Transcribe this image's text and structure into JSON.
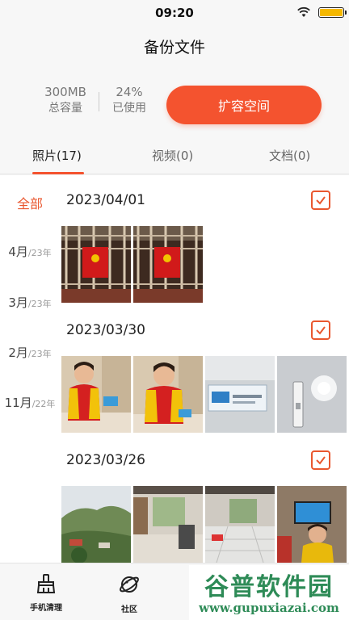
{
  "status_bar": {
    "time": "09:20",
    "battery_color": "#f5b800"
  },
  "header": {
    "title": "备份文件"
  },
  "storage": {
    "capacity_value": "300MB",
    "capacity_label": "总容量",
    "used_value": "24%",
    "used_label": "已使用",
    "expand_button": "扩容空间",
    "accent_color": "#f4532f"
  },
  "tabs": [
    {
      "label": "照片(17)",
      "active": true
    },
    {
      "label": "视频(0)",
      "active": false
    },
    {
      "label": "文档(0)",
      "active": false
    }
  ],
  "timeline": [
    {
      "main": "全部",
      "sub": ""
    },
    {
      "main": "4月",
      "sub": "/23年"
    },
    {
      "main": "3月",
      "sub": "/23年"
    },
    {
      "main": "2月",
      "sub": "/23年"
    },
    {
      "main": "11月",
      "sub": "/22年"
    }
  ],
  "groups": [
    {
      "date": "2023/04/01",
      "checked": true,
      "photos": [
        "red-banner-ceiling",
        "red-banner-ceiling"
      ]
    },
    {
      "date": "2023/03/30",
      "checked": true,
      "photos": [
        "child-yellow-vest",
        "child-yellow-vest",
        "test-kit-package",
        "test-strip"
      ]
    },
    {
      "date": "2023/03/26",
      "checked": true,
      "photos": [
        "hill-landscape",
        "living-room",
        "living-room-tiles",
        "child-watching-tv"
      ]
    }
  ],
  "bottom_nav": [
    {
      "label": "手机清理",
      "icon": "broom-icon"
    },
    {
      "label": "社区",
      "icon": "planet-icon"
    }
  ],
  "watermark": {
    "top": "谷普软件园",
    "bottom": "www.gupuxiazai.com"
  }
}
